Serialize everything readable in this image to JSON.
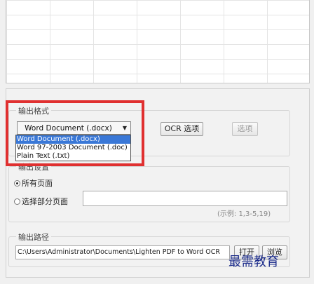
{
  "sections": {
    "output_format": "输出格式",
    "output_pages": "输出设置",
    "output_path": "输出路径"
  },
  "format_select": {
    "value": "Word Document (.docx)",
    "options": [
      "Word Document (.docx)",
      "Word 97-2003 Document (.doc)",
      "Plain Text (.txt)"
    ]
  },
  "buttons": {
    "ocr_options": "OCR 选项",
    "options": "选项",
    "open": "打开",
    "browse": "浏览"
  },
  "pages": {
    "all_label": "所有页面",
    "partial_label": "选择部分页面",
    "example": "(示例: 1,3-5,19)"
  },
  "path": {
    "value": "C:\\Users\\Administrator\\Documents\\Lighten PDF to Word OCR"
  },
  "watermark": "最需教育",
  "colors": {
    "highlight": "#e03030",
    "selection": "#3a78d7"
  }
}
